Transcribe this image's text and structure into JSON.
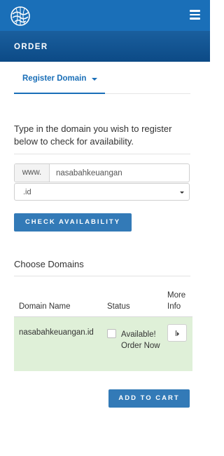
{
  "header": {
    "logo_icon": "globe-crest-icon",
    "menu_icon": "hamburger-menu-icon",
    "brand_color": "#1a6fb8",
    "dark_color": "#0c4a86"
  },
  "section": {
    "title": "ORDER"
  },
  "tabs": {
    "register_label": "Register Domain",
    "caret_icon": "caret-down-icon"
  },
  "search": {
    "intro": "Type in the domain you wish to register below to check for availability.",
    "prefix": "www.",
    "domain_value": "nasabahkeuangan",
    "tld_selected": ".id",
    "check_button": "CHECK AVAILABILITY"
  },
  "results": {
    "title": "Choose Domains",
    "columns": {
      "name": "Domain Name",
      "status": "Status",
      "more": "More Info"
    },
    "rows": [
      {
        "domain": "nasabahkeuangan.id",
        "status": "Available! Order Now",
        "more_icon": "expand-info-icon"
      }
    ],
    "status_color": "#dff0d8"
  },
  "cart": {
    "add_button": "ADD TO CART"
  }
}
